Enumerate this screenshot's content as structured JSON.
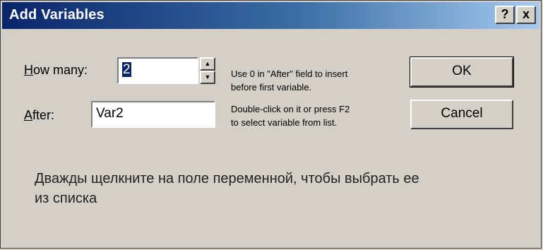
{
  "window": {
    "title": "Add Variables"
  },
  "titlebar_buttons": {
    "help": "?",
    "close": "x"
  },
  "form": {
    "how_many": {
      "label": "How many:",
      "accesskey": "H",
      "label_rest": "ow many:",
      "value": "2"
    },
    "after": {
      "label": "After:",
      "accesskey": "A",
      "label_rest": "fter:",
      "value": "Var2"
    }
  },
  "hint": {
    "line1": "Use 0 in \"After\" field to insert",
    "line2": "before first variable.",
    "line3": "Double-click on it or press F2",
    "line4": "to select variable from list."
  },
  "buttons": {
    "ok": "OK",
    "cancel": "Cancel"
  },
  "note": "Дважды щелкните на поле переменной, чтобы выбрать ее из списка",
  "colors": {
    "titlebar_start": "#0a246a",
    "titlebar_end": "#a6caf0",
    "dialog_bg": "#d4d0c8"
  }
}
